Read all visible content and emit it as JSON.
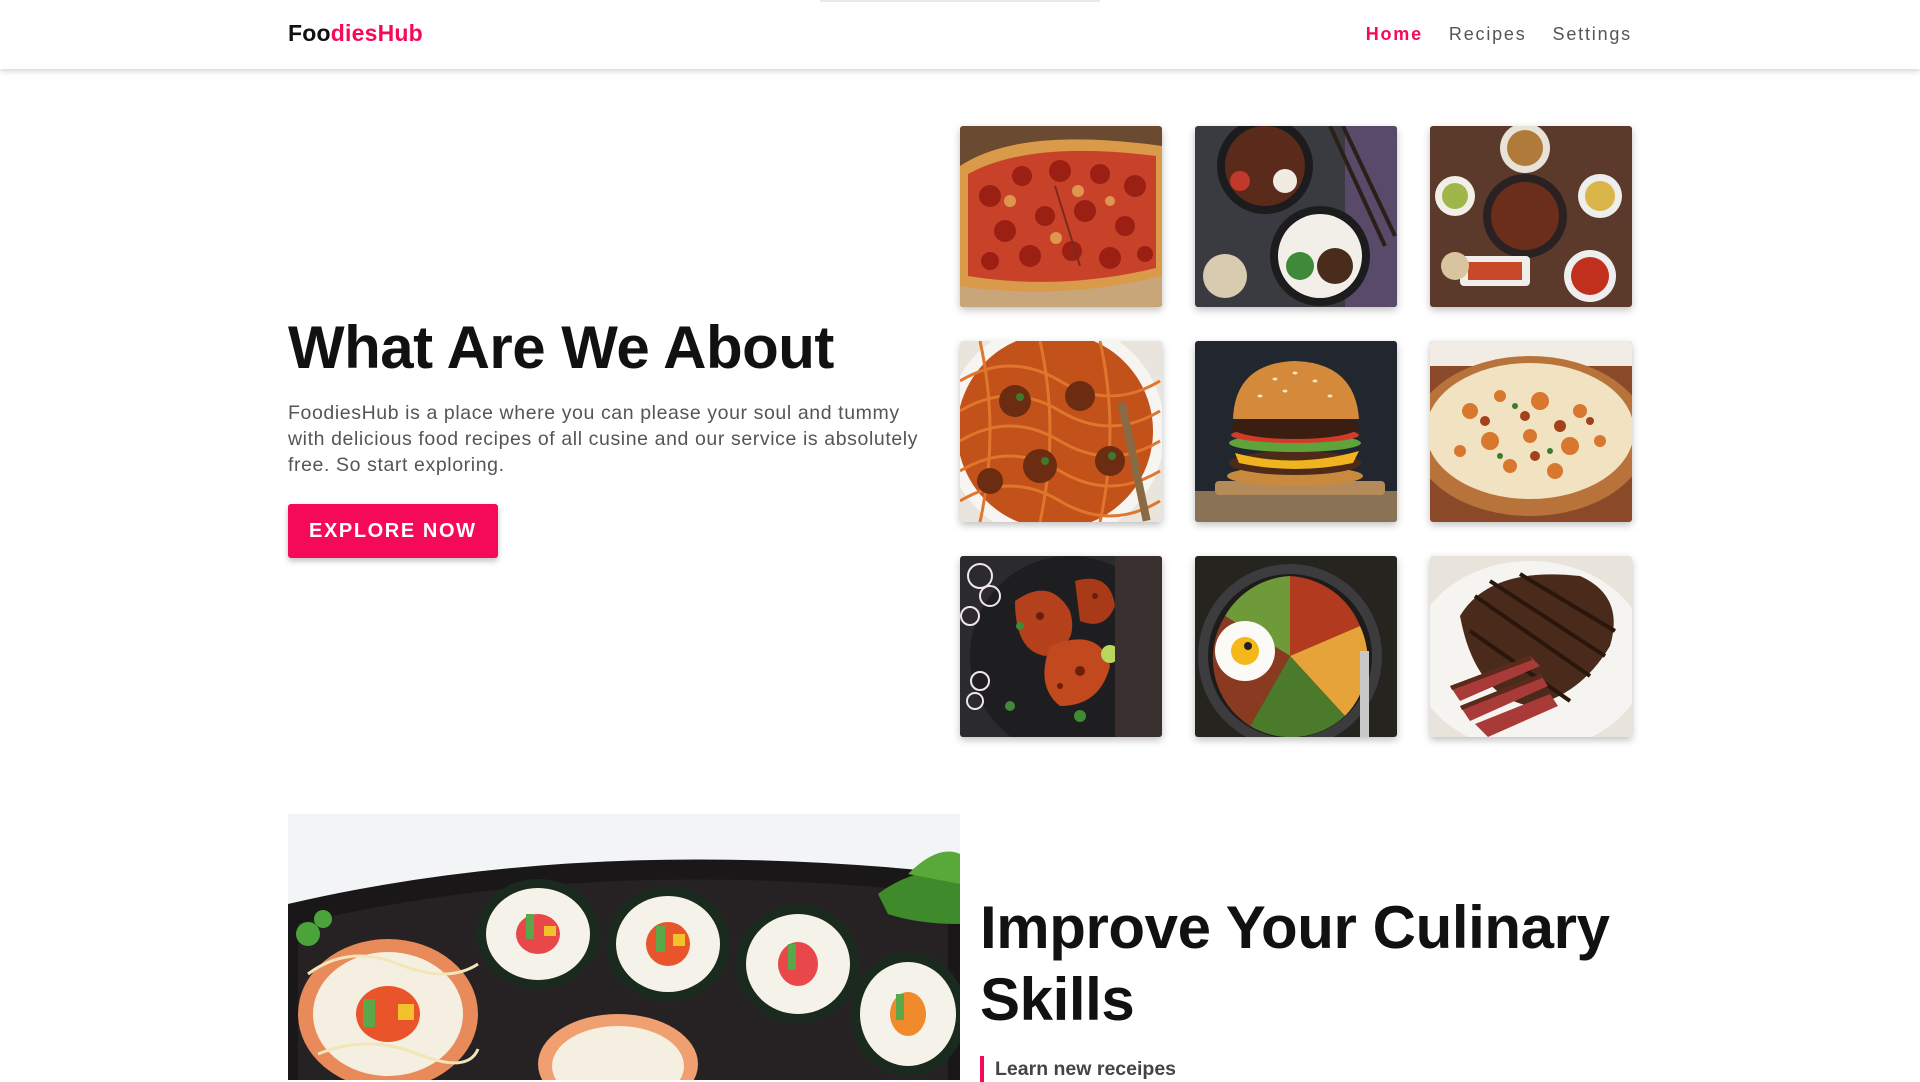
{
  "brand": {
    "part_dark": "Foo",
    "part_accent": "diesHub"
  },
  "nav": {
    "items": [
      {
        "label": "Home",
        "active": true
      },
      {
        "label": "Recipes",
        "active": false
      },
      {
        "label": "Settings",
        "active": false
      }
    ]
  },
  "hero": {
    "title": "What Are We About",
    "description": "FoodiesHub is a place where you can please your soul and tummy with delicious food recipes of all cusine and our service is absolutely free. So start exploring.",
    "button_label": "EXPLORE NOW"
  },
  "gallery": {
    "images": [
      {
        "icon": "pizza-image"
      },
      {
        "icon": "rice-bowls-image"
      },
      {
        "icon": "korean-table-image"
      },
      {
        "icon": "spaghetti-meatballs-image"
      },
      {
        "icon": "burger-image"
      },
      {
        "icon": "biryani-image"
      },
      {
        "icon": "tandoori-chicken-image"
      },
      {
        "icon": "bibimbap-image"
      },
      {
        "icon": "steak-image"
      }
    ]
  },
  "skills": {
    "title": "Improve Your Culinary Skills",
    "points": [
      "Learn new receipes"
    ],
    "image": "sushi-image"
  },
  "colors": {
    "accent": "#f50a5a",
    "heading": "#111111",
    "body_text": "#555555"
  }
}
